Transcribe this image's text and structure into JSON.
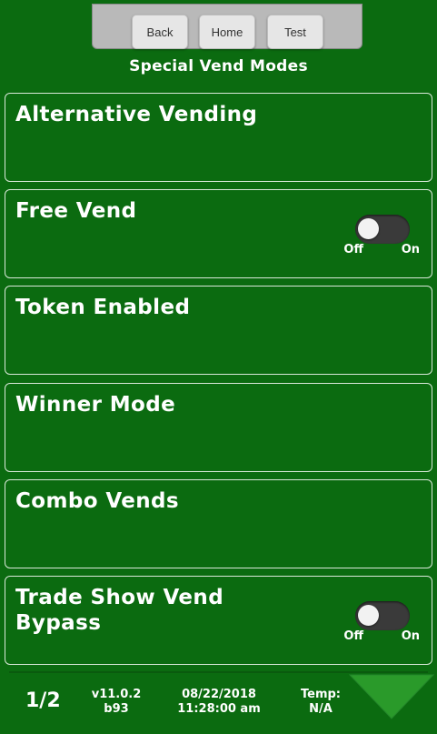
{
  "nav": {
    "back_label": "Back",
    "home_label": "Home",
    "test_label": "Test"
  },
  "header": {
    "title": "Special Vend Modes"
  },
  "menu": {
    "items": [
      {
        "label": "Alternative Vending"
      },
      {
        "label": "Free Vend",
        "toggle_state": "off"
      },
      {
        "label": "Token Enabled"
      },
      {
        "label": "Winner Mode"
      },
      {
        "label": "Combo Vends"
      },
      {
        "label": "Trade Show Vend Bypass",
        "toggle_state": "off"
      }
    ],
    "toggle_off_label": "Off",
    "toggle_on_label": "On"
  },
  "footer": {
    "page": "1/2",
    "version_line1": "v11.0.2",
    "version_line2": "b93",
    "date": "08/22/2018",
    "time": "11:28:00 am",
    "temp_label": "Temp:",
    "temp_value": "N/A",
    "next_icon": "triangle-down-icon"
  },
  "colors": {
    "background": "#0b6b10",
    "arrow": "#2a9a2a",
    "tray": "#b9b9b9"
  }
}
